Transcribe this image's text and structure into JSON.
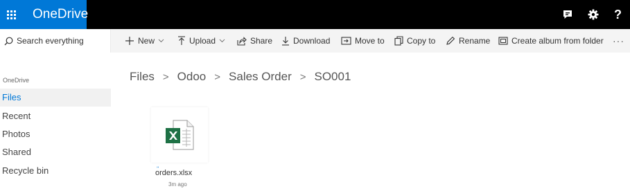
{
  "app": {
    "title": "OneDrive",
    "accent_color": "#0078d7",
    "topbar_color": "#000000",
    "top_icons": [
      "chat-icon",
      "gear-icon",
      "help-icon"
    ],
    "help_label": "?"
  },
  "search": {
    "label": "Search everything",
    "icon": "search-icon"
  },
  "commands": {
    "new": "New",
    "upload": "Upload",
    "share": "Share",
    "download": "Download",
    "move_to": "Move to",
    "copy_to": "Copy to",
    "rename": "Rename",
    "create_album": "Create album from folder",
    "more": "···"
  },
  "nav": {
    "heading": "OneDrive",
    "items": [
      {
        "label": "Files",
        "active": true
      },
      {
        "label": "Recent",
        "active": false
      },
      {
        "label": "Photos",
        "active": false
      },
      {
        "label": "Shared",
        "active": false
      },
      {
        "label": "Recycle bin",
        "active": false
      }
    ]
  },
  "breadcrumb": {
    "items": [
      "Files",
      "Odoo",
      "Sales Order",
      "SO001"
    ],
    "separator": ">"
  },
  "files": [
    {
      "name": "orders.xlsx",
      "modified": "3m ago",
      "icon": "excel-file-icon",
      "sync_mark": "ʼʼ"
    }
  ]
}
